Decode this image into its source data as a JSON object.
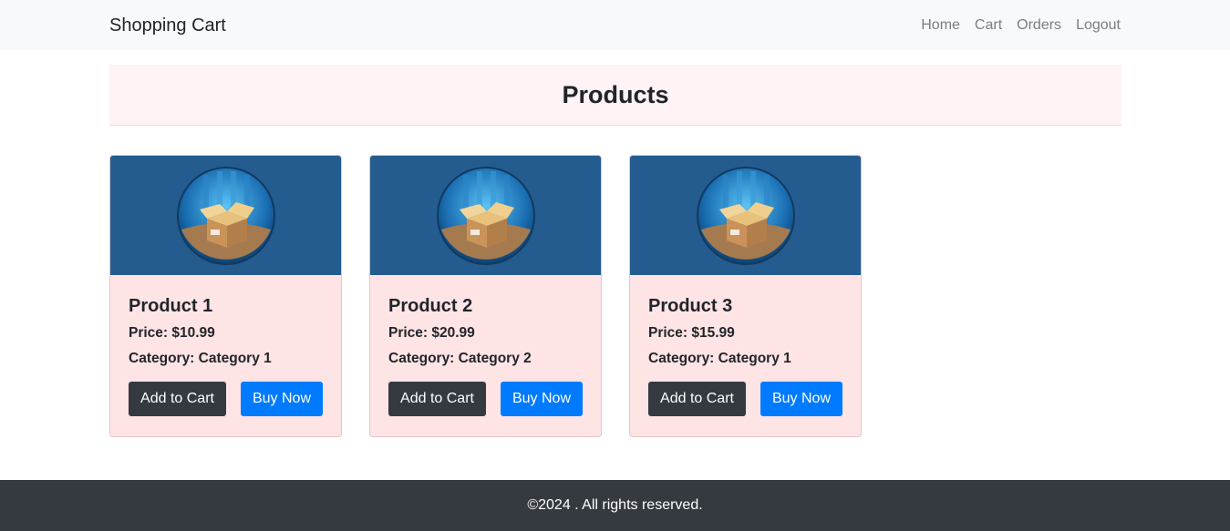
{
  "navbar": {
    "brand": "Shopping Cart",
    "links": [
      "Home",
      "Cart",
      "Orders",
      "Logout"
    ]
  },
  "header": {
    "title": "Products"
  },
  "products": [
    {
      "name": "Product 1",
      "price": "Price: $10.99",
      "category": "Category: Category 1",
      "add_label": "Add to Cart",
      "buy_label": "Buy Now"
    },
    {
      "name": "Product 2",
      "price": "Price: $20.99",
      "category": "Category: Category 2",
      "add_label": "Add to Cart",
      "buy_label": "Buy Now"
    },
    {
      "name": "Product 3",
      "price": "Price: $15.99",
      "category": "Category: Category 1",
      "add_label": "Add to Cart",
      "buy_label": "Buy Now"
    }
  ],
  "product_image_icon": "box-product-icon",
  "footer": {
    "text": "©2024 . All rights reserved."
  },
  "colors": {
    "primary": "#007bff",
    "dark": "#343a40",
    "card_bg": "#ffe4e6",
    "image_bg": "#245c90"
  }
}
